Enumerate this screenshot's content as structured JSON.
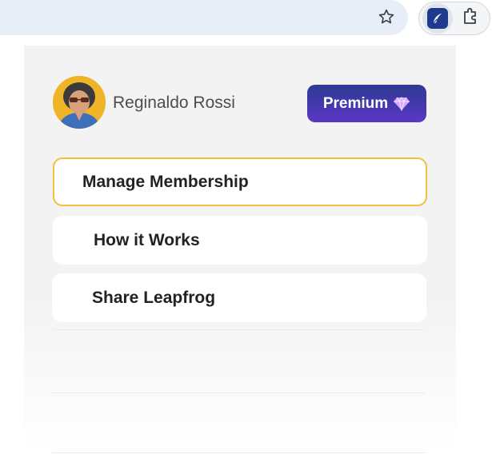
{
  "browser": {
    "star_icon": "star-icon",
    "extension_icon": "leapfrog-feather-icon",
    "extensions_menu_icon": "puzzle-piece-icon"
  },
  "popup": {
    "user": {
      "name": "Reginaldo Rossi",
      "avatar_icon": "user-avatar"
    },
    "premium_button": {
      "label": "Premium",
      "icon": "gem-icon"
    },
    "menu": [
      {
        "label": "Manage Membership",
        "selected": true
      },
      {
        "label": "How it Works",
        "selected": false
      },
      {
        "label": "Share Leapfrog",
        "selected": false
      }
    ]
  },
  "colors": {
    "premium_gradient_start": "#2c3a92",
    "premium_gradient_end": "#5a37c6",
    "selected_border": "#f2c03f",
    "avatar_background": "#f0b429",
    "extension_tile": "#1f3a8c"
  }
}
